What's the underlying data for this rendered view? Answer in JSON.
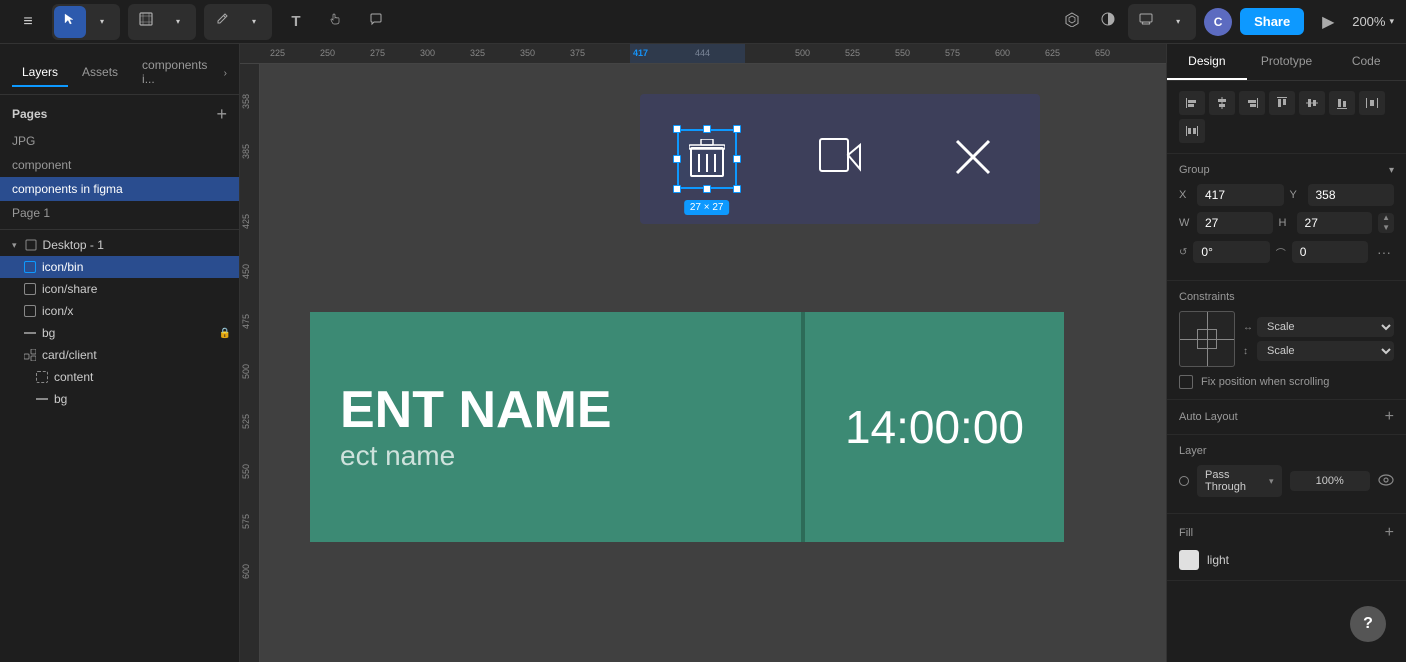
{
  "toolbar": {
    "menu_icon": "≡",
    "cursor_icon": "↖",
    "frame_icon": "⬜",
    "pencil_icon": "✏",
    "text_icon": "T",
    "hand_icon": "✋",
    "comment_icon": "💬",
    "share_label": "Share",
    "zoom_level": "200%",
    "avatar_initials": "C",
    "play_icon": "▶",
    "plugins_icon": "⬡",
    "theme_icon": "◐",
    "remote_icon": "🖥"
  },
  "left_panel": {
    "tab_layers": "Layers",
    "tab_assets": "Assets",
    "tab_components": "components i...",
    "pages_title": "Pages",
    "pages_add": "+",
    "pages": [
      {
        "label": "JPG"
      },
      {
        "label": "component"
      },
      {
        "label": "components in figma",
        "active": true
      },
      {
        "label": "Page 1"
      }
    ],
    "layers": [
      {
        "label": "Desktop - 1",
        "indent": 0,
        "icon": "◻",
        "expanded": true,
        "type": "frame"
      },
      {
        "label": "icon/bin",
        "indent": 1,
        "icon": "⊞",
        "selected": true,
        "type": "component"
      },
      {
        "label": "icon/share",
        "indent": 1,
        "icon": "⊞",
        "type": "component"
      },
      {
        "label": "icon/x",
        "indent": 1,
        "icon": "⊞",
        "type": "component"
      },
      {
        "label": "bg",
        "indent": 1,
        "icon": "—",
        "type": "rect",
        "lock": true
      },
      {
        "label": "card/client",
        "indent": 1,
        "icon": "⊕",
        "type": "component"
      },
      {
        "label": "content",
        "indent": 2,
        "icon": "⊞",
        "type": "component"
      },
      {
        "label": "bg",
        "indent": 2,
        "icon": "—",
        "type": "rect"
      }
    ]
  },
  "canvas": {
    "ruler_marks": [
      "225",
      "250",
      "275",
      "300",
      "325",
      "350",
      "375",
      "417",
      "444",
      "500",
      "525",
      "550",
      "575",
      "600",
      "625",
      "650"
    ],
    "ruler_marks_v": [
      "358",
      "385",
      "425",
      "450",
      "475",
      "500",
      "525",
      "550",
      "575",
      "600"
    ],
    "selection_label": "27 × 27",
    "event_name": "ENT NAME",
    "event_subname": "ect name",
    "event_time": "14:00:00"
  },
  "right_panel": {
    "tab_design": "Design",
    "tab_prototype": "Prototype",
    "tab_code": "Code",
    "group_label": "Group",
    "x_label": "X",
    "x_value": "417",
    "y_label": "Y",
    "y_value": "358",
    "w_label": "W",
    "w_value": "27",
    "h_label": "H",
    "h_value": "27",
    "rotation_label": "0°",
    "corner_label": "0",
    "constraints_title": "Constraints",
    "constraint_h_label": "↔",
    "constraint_h_value": "Scale",
    "constraint_v_label": "↕",
    "constraint_v_value": "Scale",
    "fix_position_label": "Fix position when scrolling",
    "auto_layout_title": "Auto Layout",
    "auto_layout_add": "+",
    "layer_title": "Layer",
    "blend_mode": "Pass Through",
    "opacity_value": "100%",
    "fill_title": "Fill",
    "fill_add": "+",
    "fill_color_label": "light",
    "help_label": "?"
  }
}
